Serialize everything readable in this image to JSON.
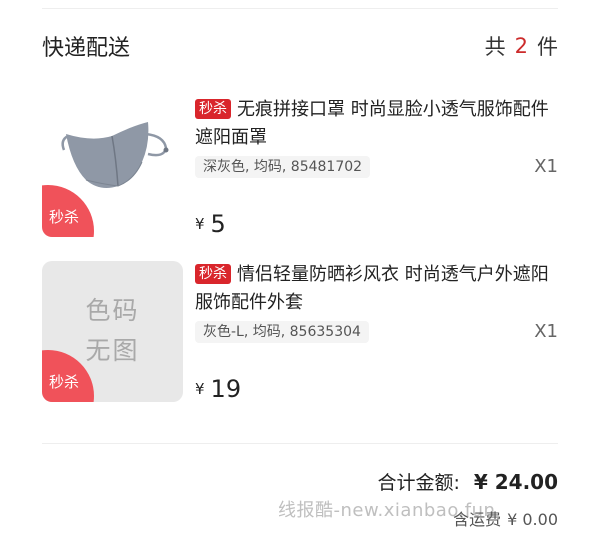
{
  "section": {
    "title": "快递配送",
    "count_prefix": "共",
    "count": "2",
    "count_suffix": "件"
  },
  "items": [
    {
      "tag": "秒杀",
      "title": "无痕拼接口罩 时尚显脸小透气服饰配件遮阳面罩",
      "spec": "深灰色, 均码, 85481702",
      "qty": "X1",
      "currency": "¥",
      "price": "5",
      "thumb_badge": "秒杀",
      "thumb_icon": "face-mask-image"
    },
    {
      "tag": "秒杀",
      "title": "情侣轻量防晒衫风衣 时尚透气户外遮阳服饰配件外套",
      "spec": "灰色-L, 均码, 85635304",
      "qty": "X1",
      "currency": "¥",
      "price": "19",
      "thumb_badge": "秒杀",
      "thumb_placeholder_line1": "色码",
      "thumb_placeholder_line2": "无图"
    }
  ],
  "summary": {
    "total_label": "合计金额:",
    "total_value": "¥ 24.00",
    "shipping_label": "含运费",
    "shipping_value": "¥ 0.00"
  },
  "watermark": "线报酷-new.xianbao.fun",
  "colors": {
    "accent_red": "#d9262c",
    "badge_red": "#f0525a",
    "count_red": "#cc2b2b"
  }
}
